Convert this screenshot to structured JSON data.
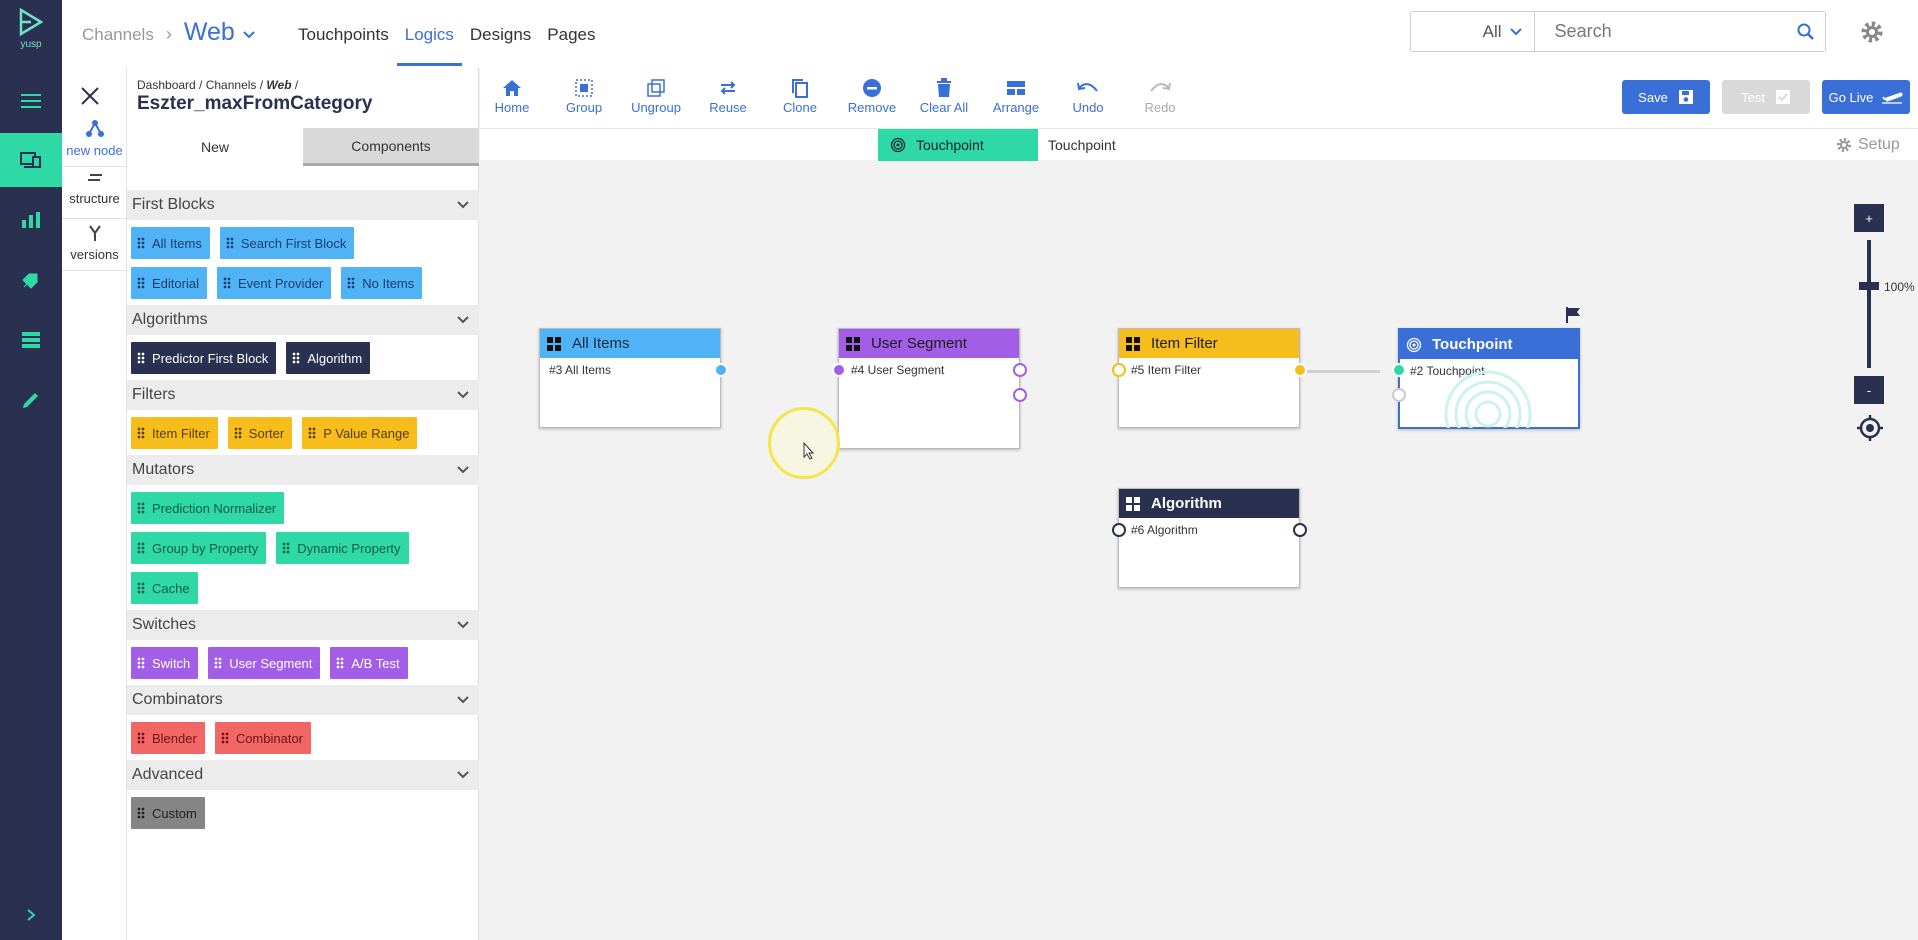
{
  "brand": {
    "logo_text": "yusp"
  },
  "topbar": {
    "channels": "Channels",
    "current": "Web",
    "nav": [
      "Touchpoints",
      "Logics",
      "Designs",
      "Pages"
    ],
    "active_nav": "Logics",
    "filter_value": "All",
    "search_placeholder": "Search"
  },
  "tools": [
    {
      "label": "new node"
    },
    {
      "label": "structure"
    },
    {
      "label": "versions"
    }
  ],
  "panel": {
    "breadcrumb_prefix": "Dashboard / Channels / ",
    "breadcrumb_web": "Web",
    "breadcrumb_suffix": " /",
    "title": "Eszter_maxFromCategory",
    "tab_new": "New",
    "tab_components": "Components"
  },
  "categories": [
    {
      "name": "First Blocks",
      "color": "c-blue",
      "items": [
        "All Items",
        "Search First Block",
        "Editorial",
        "Event Provider",
        "No Items"
      ]
    },
    {
      "name": "Algorithms",
      "color": "c-navy",
      "items": [
        "Predictor First Block",
        "Algorithm"
      ]
    },
    {
      "name": "Filters",
      "color": "c-yellow",
      "items": [
        "Item Filter",
        "Sorter",
        "P Value Range"
      ]
    },
    {
      "name": "Mutators",
      "color": "c-teal",
      "items": [
        "Prediction Normalizer",
        "Group by Property",
        "Dynamic Property",
        "Cache"
      ]
    },
    {
      "name": "Switches",
      "color": "c-purple",
      "items": [
        "Switch",
        "User Segment",
        "A/B Test"
      ]
    },
    {
      "name": "Combinators",
      "color": "c-red",
      "items": [
        "Blender",
        "Combinator"
      ]
    },
    {
      "name": "Advanced",
      "color": "c-gray",
      "items": [
        "Custom"
      ]
    }
  ],
  "toolbar": {
    "home": "Home",
    "group": "Group",
    "ungroup": "Ungroup",
    "reuse": "Reuse",
    "clone": "Clone",
    "remove": "Remove",
    "clear_all": "Clear All",
    "arrange": "Arrange",
    "undo": "Undo",
    "redo": "Redo",
    "save": "Save",
    "test": "Test",
    "go_live": "Go Live"
  },
  "touchpoint_strip": {
    "tab_label": "Touchpoint",
    "name": "Touchpoint",
    "setup": "Setup"
  },
  "nodes": {
    "all_items": {
      "title": "All Items",
      "sub": "#3 All Items",
      "color": "#4fb3f5"
    },
    "user_segment": {
      "title": "User Segment",
      "sub": "#4 User Segment",
      "color": "#a35ee8"
    },
    "item_filter": {
      "title": "Item Filter",
      "sub": "#5 Item Filter",
      "color": "#f6bd1c"
    },
    "touchpoint": {
      "title": "Touchpoint",
      "sub": "#2 Touchpoint",
      "color": "#3b6fd8"
    },
    "algorithm": {
      "title": "Algorithm",
      "sub": "#6 Algorithm",
      "color": "#2a3150"
    }
  },
  "zoom": {
    "plus": "+",
    "minus": "-",
    "level": "100%"
  }
}
